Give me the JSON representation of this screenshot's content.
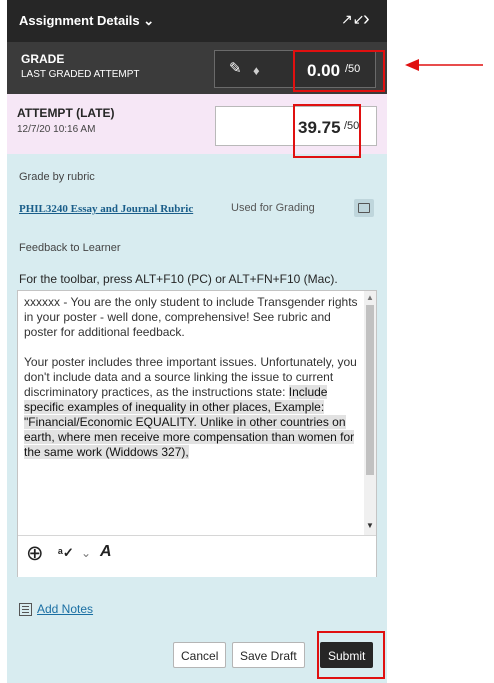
{
  "header": {
    "title": "Assignment Details",
    "chevron": "chevron-down-icon",
    "expand_icon": "expand-icon",
    "next_icon": "chevron-right-icon"
  },
  "grade": {
    "label": "GRADE",
    "sublabel": "LAST GRADED ATTEMPT",
    "value": "0.00",
    "out_of": "/50"
  },
  "attempt": {
    "label": "ATTEMPT (LATE)",
    "timestamp": "12/7/20 10:16 AM",
    "value": "39.75",
    "out_of": "/50"
  },
  "rubric": {
    "heading": "Grade by rubric",
    "link": "PHIL3240 Essay and Journal Rubric",
    "status": "Used for Grading"
  },
  "feedback": {
    "heading": "Feedback to Learner",
    "toolbar_hint": "For the toolbar, press ALT+F10 (PC) or ALT+FN+F10 (Mac).",
    "para1": "xxxxxx - You are the only student to include Transgender rights in your poster - well done, comprehensive! See rubric and poster for additional feedback.",
    "para2_plain": "Your poster includes three important issues. Unfortunately, you don't include data and a source linking the issue to current discriminatory practices, as the instructions state: ",
    "para2_highlight": "Include specific examples of inequality in other places, Example: \"Financial/Economic EQUALITY. Unlike in other countries on earth, where men receive more compensation than women for the same work (Widdows 327),"
  },
  "notes": {
    "label": "Add Notes"
  },
  "actions": {
    "cancel": "Cancel",
    "save_draft": "Save Draft",
    "submit": "Submit"
  },
  "colors": {
    "annotation": "#e01010",
    "header_bg": "#262626",
    "panel_bg": "#d8ecf0",
    "attempt_bg": "#f6e7f6"
  }
}
